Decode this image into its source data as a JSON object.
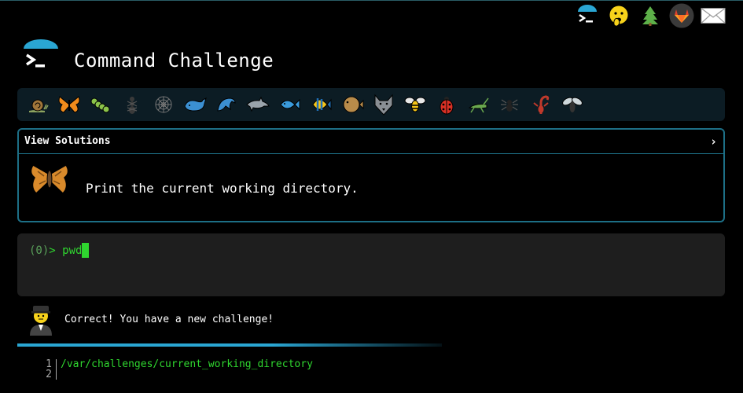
{
  "header": {
    "title": "Command Challenge"
  },
  "top_icons": [
    "terminal-logo-icon",
    "hushed-face-icon",
    "tree-icon",
    "gitlab-icon",
    "mail-icon"
  ],
  "challenge_bar": {
    "icons": [
      "snail",
      "butterfly",
      "caterpillar",
      "ant",
      "spider-web",
      "whale",
      "dolphin-jumping",
      "dolphin",
      "fish",
      "tropical-fish",
      "blowfish",
      "wolf",
      "bee",
      "ladybug",
      "cricket",
      "spider",
      "scorpion",
      "fly"
    ]
  },
  "solutions": {
    "label": "View Solutions",
    "chevron": "›"
  },
  "task": {
    "text": "Print the current working directory."
  },
  "terminal": {
    "prompt_num": "(0)",
    "prompt_arrow": ">",
    "command": "pwd"
  },
  "result": {
    "message": "Correct! You have a new challenge!",
    "progress": 1.0
  },
  "output": {
    "lines": [
      {
        "num": "1",
        "text": "/var/challenges/current_working_directory"
      },
      {
        "num": "2",
        "text": ""
      }
    ]
  },
  "colors": {
    "accent": "#1d6f86",
    "prompt_green": "#2fd62f",
    "panel_bg": "#0c1c24",
    "terminal_bg": "#1e1e1e"
  }
}
